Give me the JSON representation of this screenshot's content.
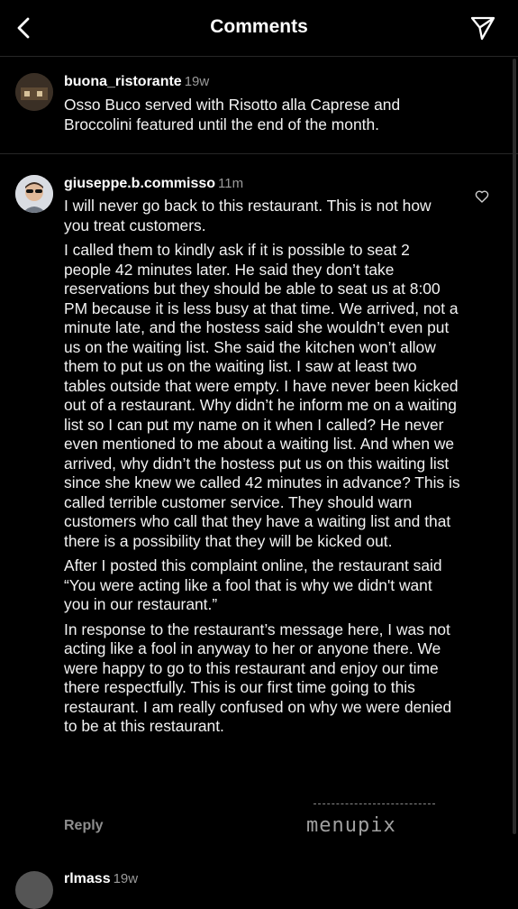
{
  "header": {
    "title": "Comments",
    "back_icon": "chevron-left-icon",
    "send_icon": "paper-plane-icon"
  },
  "caption": {
    "username": "buona_ristorante",
    "time": "19w",
    "text": "Osso Buco served with Risotto alla Caprese and Broccolini featured until the end of the month."
  },
  "comments": [
    {
      "username": "giuseppe.b.commisso",
      "time": "11m",
      "paragraphs": [
        "I will never go back to this restaurant.  This is not how you treat customers.",
        "I called them to kindly ask if it is possible to seat 2 people 42 minutes later.  He said they don’t take reservations but they should be able to seat us at 8:00 PM because it is less busy at that time.  We arrived, not a minute late, and the hostess said she wouldn’t even put us on the waiting list.  She said the kitchen won’t allow them to put us on the waiting list.  I saw at least two tables outside that were empty.  I have never been kicked out of a restaurant.  Why didn’t he inform me on a waiting list so I can put my name on it when I called?  He never even mentioned to me about a waiting list.  And when we arrived, why didn’t the hostess put us on this waiting list since she knew we called 42 minutes in advance?  This is called terrible customer service. They should warn customers who call that they have a waiting list and that there is a possibility that they will be kicked out.",
        "After I posted this complaint online, the restaurant said “You were acting like a fool that is why we didn't want you in our restaurant.”",
        "In response to the restaurant’s message here,  I was not acting like a fool in anyway to her or anyone there.  We were happy to go to this restaurant and enjoy our time there respectfully. This is our first time going to this restaurant.  I am really confused on why we were denied to be at this restaurant."
      ],
      "reply_label": "Reply",
      "like_icon": "heart-outline-icon"
    },
    {
      "username": "rlmass",
      "time": "19w"
    }
  ],
  "watermark": "menupix"
}
